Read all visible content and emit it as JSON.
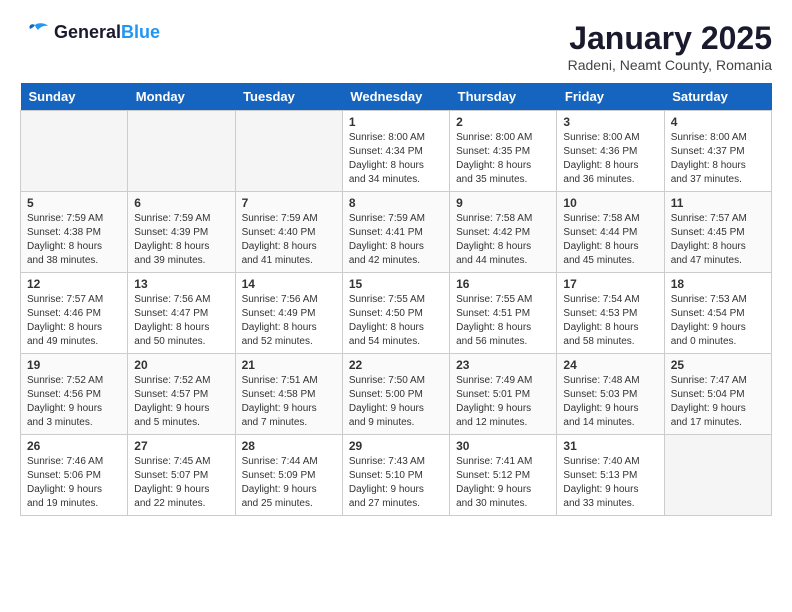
{
  "header": {
    "logo_line1": "General",
    "logo_line2": "Blue",
    "title": "January 2025",
    "location": "Radeni, Neamt County, Romania"
  },
  "days_of_week": [
    "Sunday",
    "Monday",
    "Tuesday",
    "Wednesday",
    "Thursday",
    "Friday",
    "Saturday"
  ],
  "weeks": [
    [
      {
        "day": "",
        "info": ""
      },
      {
        "day": "",
        "info": ""
      },
      {
        "day": "",
        "info": ""
      },
      {
        "day": "1",
        "info": "Sunrise: 8:00 AM\nSunset: 4:34 PM\nDaylight: 8 hours\nand 34 minutes."
      },
      {
        "day": "2",
        "info": "Sunrise: 8:00 AM\nSunset: 4:35 PM\nDaylight: 8 hours\nand 35 minutes."
      },
      {
        "day": "3",
        "info": "Sunrise: 8:00 AM\nSunset: 4:36 PM\nDaylight: 8 hours\nand 36 minutes."
      },
      {
        "day": "4",
        "info": "Sunrise: 8:00 AM\nSunset: 4:37 PM\nDaylight: 8 hours\nand 37 minutes."
      }
    ],
    [
      {
        "day": "5",
        "info": "Sunrise: 7:59 AM\nSunset: 4:38 PM\nDaylight: 8 hours\nand 38 minutes."
      },
      {
        "day": "6",
        "info": "Sunrise: 7:59 AM\nSunset: 4:39 PM\nDaylight: 8 hours\nand 39 minutes."
      },
      {
        "day": "7",
        "info": "Sunrise: 7:59 AM\nSunset: 4:40 PM\nDaylight: 8 hours\nand 41 minutes."
      },
      {
        "day": "8",
        "info": "Sunrise: 7:59 AM\nSunset: 4:41 PM\nDaylight: 8 hours\nand 42 minutes."
      },
      {
        "day": "9",
        "info": "Sunrise: 7:58 AM\nSunset: 4:42 PM\nDaylight: 8 hours\nand 44 minutes."
      },
      {
        "day": "10",
        "info": "Sunrise: 7:58 AM\nSunset: 4:44 PM\nDaylight: 8 hours\nand 45 minutes."
      },
      {
        "day": "11",
        "info": "Sunrise: 7:57 AM\nSunset: 4:45 PM\nDaylight: 8 hours\nand 47 minutes."
      }
    ],
    [
      {
        "day": "12",
        "info": "Sunrise: 7:57 AM\nSunset: 4:46 PM\nDaylight: 8 hours\nand 49 minutes."
      },
      {
        "day": "13",
        "info": "Sunrise: 7:56 AM\nSunset: 4:47 PM\nDaylight: 8 hours\nand 50 minutes."
      },
      {
        "day": "14",
        "info": "Sunrise: 7:56 AM\nSunset: 4:49 PM\nDaylight: 8 hours\nand 52 minutes."
      },
      {
        "day": "15",
        "info": "Sunrise: 7:55 AM\nSunset: 4:50 PM\nDaylight: 8 hours\nand 54 minutes."
      },
      {
        "day": "16",
        "info": "Sunrise: 7:55 AM\nSunset: 4:51 PM\nDaylight: 8 hours\nand 56 minutes."
      },
      {
        "day": "17",
        "info": "Sunrise: 7:54 AM\nSunset: 4:53 PM\nDaylight: 8 hours\nand 58 minutes."
      },
      {
        "day": "18",
        "info": "Sunrise: 7:53 AM\nSunset: 4:54 PM\nDaylight: 9 hours\nand 0 minutes."
      }
    ],
    [
      {
        "day": "19",
        "info": "Sunrise: 7:52 AM\nSunset: 4:56 PM\nDaylight: 9 hours\nand 3 minutes."
      },
      {
        "day": "20",
        "info": "Sunrise: 7:52 AM\nSunset: 4:57 PM\nDaylight: 9 hours\nand 5 minutes."
      },
      {
        "day": "21",
        "info": "Sunrise: 7:51 AM\nSunset: 4:58 PM\nDaylight: 9 hours\nand 7 minutes."
      },
      {
        "day": "22",
        "info": "Sunrise: 7:50 AM\nSunset: 5:00 PM\nDaylight: 9 hours\nand 9 minutes."
      },
      {
        "day": "23",
        "info": "Sunrise: 7:49 AM\nSunset: 5:01 PM\nDaylight: 9 hours\nand 12 minutes."
      },
      {
        "day": "24",
        "info": "Sunrise: 7:48 AM\nSunset: 5:03 PM\nDaylight: 9 hours\nand 14 minutes."
      },
      {
        "day": "25",
        "info": "Sunrise: 7:47 AM\nSunset: 5:04 PM\nDaylight: 9 hours\nand 17 minutes."
      }
    ],
    [
      {
        "day": "26",
        "info": "Sunrise: 7:46 AM\nSunset: 5:06 PM\nDaylight: 9 hours\nand 19 minutes."
      },
      {
        "day": "27",
        "info": "Sunrise: 7:45 AM\nSunset: 5:07 PM\nDaylight: 9 hours\nand 22 minutes."
      },
      {
        "day": "28",
        "info": "Sunrise: 7:44 AM\nSunset: 5:09 PM\nDaylight: 9 hours\nand 25 minutes."
      },
      {
        "day": "29",
        "info": "Sunrise: 7:43 AM\nSunset: 5:10 PM\nDaylight: 9 hours\nand 27 minutes."
      },
      {
        "day": "30",
        "info": "Sunrise: 7:41 AM\nSunset: 5:12 PM\nDaylight: 9 hours\nand 30 minutes."
      },
      {
        "day": "31",
        "info": "Sunrise: 7:40 AM\nSunset: 5:13 PM\nDaylight: 9 hours\nand 33 minutes."
      },
      {
        "day": "",
        "info": ""
      }
    ]
  ]
}
